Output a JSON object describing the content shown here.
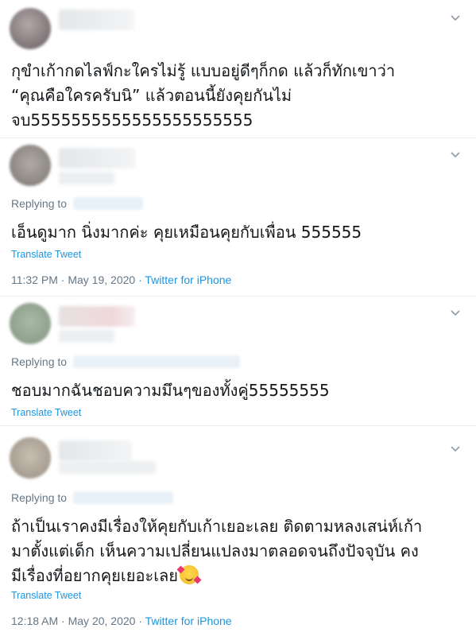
{
  "tweets": [
    {
      "text": "กุขำเก้ากดไลฟ์กะใครไม่รู้ แบบอยู่ดีๆก็กด แล้วก็ทักเขาว่า\n“คุณคือใครครับนิ” แล้วตอนนี้ยังคุยกันไม่\nจบ5555555555555555555555"
    },
    {
      "replying_label": "Replying to",
      "text": "เอ็นดูมาก นิ่งมากค่ะ คุยเหมือนคุยกับเพื่อน 555555",
      "translate_label": "Translate Tweet",
      "time": "11:32 PM",
      "date": "May 19, 2020",
      "source": "Twitter for iPhone"
    },
    {
      "replying_label": "Replying to",
      "text": "ชอบมากฉันชอบความมึนๆของทั้งคู่55555555",
      "translate_label": "Translate Tweet"
    },
    {
      "replying_label": "Replying to",
      "text": "ถ้าเป็นเราคงมีเรื่องให้คุยกับเก้าเยอะเลย ติดตามหลงเสน่ห์เก้า\nมาตั้งแต่เด็ก เห็นความเปลี่ยนแปลงมาตลอดจนถึงปัจจุบัน คง\nมีเรื่องที่อยากคุยเยอะเลย",
      "translate_label": "Translate Tweet",
      "time": "12:18 AM",
      "date": "May 20, 2020",
      "source": "Twitter for iPhone"
    }
  ],
  "meta_separator": "·",
  "icons": {
    "caret": "chevron-down-icon",
    "emoji": "smiling-face-with-hearts-icon"
  },
  "colors": {
    "link": "#1b95e0",
    "muted": "#657786",
    "divider": "#e6ecf0"
  }
}
